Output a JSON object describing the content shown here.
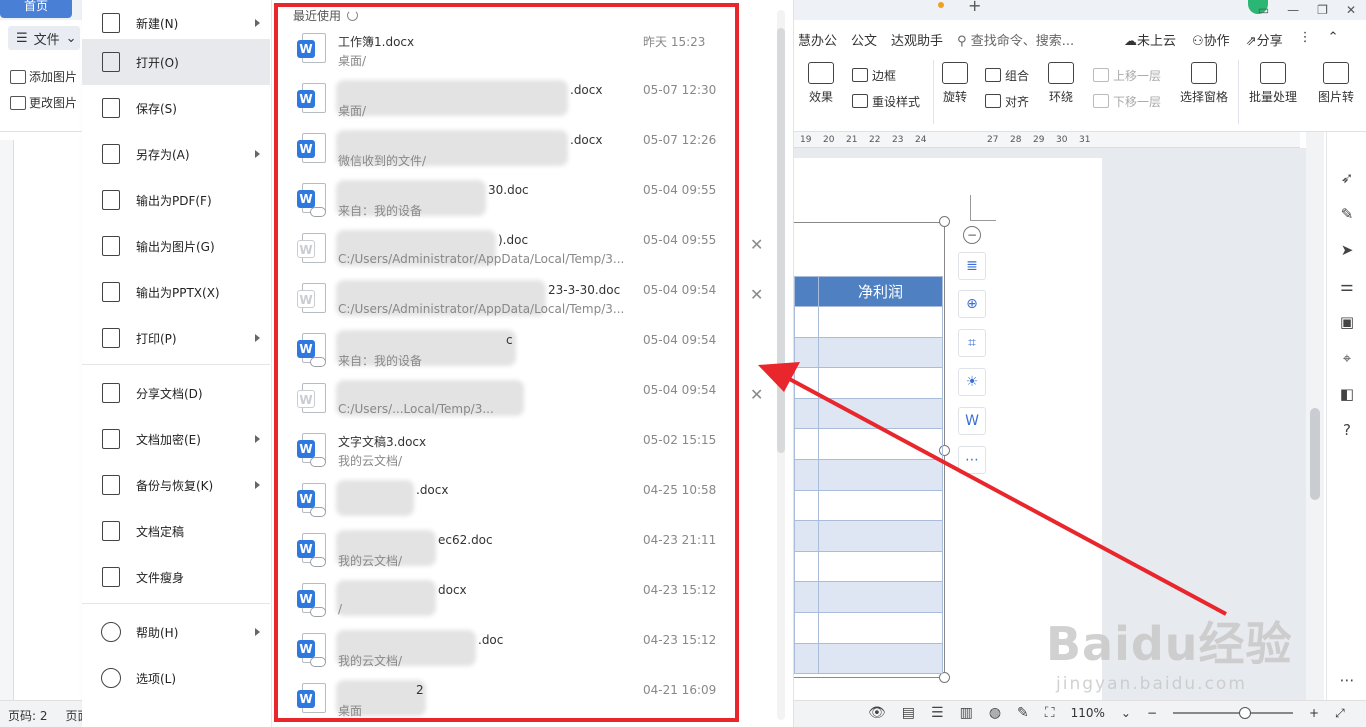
{
  "tabs": {
    "home": "首页"
  },
  "menubar": {
    "file_label": "文件",
    "items": [
      "慧办公",
      "公文",
      "达观助手"
    ],
    "search_placeholder": "查找命令、搜索...",
    "right": [
      "未上云",
      "协作",
      "分享"
    ]
  },
  "ribbon": {
    "left": [
      "添加图片",
      "更改图片"
    ],
    "border": "边框",
    "effect": "效果",
    "reset_style": "重设样式",
    "rotate": "旋转",
    "group": "组合",
    "align": "对齐",
    "wrap": "环绕",
    "move_up": "上移一层",
    "move_down": "下移一层",
    "select_pane": "选择窗格",
    "batch": "批量处理",
    "image_tools": "图片转"
  },
  "ruler": {
    "marks": [
      "19",
      "20",
      "21",
      "22",
      "23",
      "24",
      "27",
      "28",
      "29",
      "30",
      "31"
    ]
  },
  "table": {
    "header": "净利润"
  },
  "status": {
    "page": "页码: 2",
    "page2": "页面",
    "zoom": "110%"
  },
  "watermark": {
    "main": "Baidu经验",
    "sub": "jingyan.baidu.com"
  },
  "file_menu": {
    "items": [
      {
        "label": "新建(N)",
        "arrow": true,
        "icon": "new-icon"
      },
      {
        "label": "打开(O)",
        "arrow": false,
        "icon": "open-folder-icon"
      },
      {
        "label": "保存(S)",
        "arrow": false,
        "icon": "save-icon"
      },
      {
        "label": "另存为(A)",
        "arrow": true,
        "icon": "save-as-icon"
      },
      {
        "label": "输出为PDF(F)",
        "arrow": false,
        "icon": "pdf-icon"
      },
      {
        "label": "输出为图片(G)",
        "arrow": false,
        "icon": "image-export-icon"
      },
      {
        "label": "输出为PPTX(X)",
        "arrow": false,
        "icon": "pptx-icon"
      },
      {
        "label": "打印(P)",
        "arrow": true,
        "icon": "print-icon"
      },
      {
        "label": "分享文档(D)",
        "arrow": false,
        "icon": "share-icon"
      },
      {
        "label": "文档加密(E)",
        "arrow": true,
        "icon": "encrypt-icon"
      },
      {
        "label": "备份与恢复(K)",
        "arrow": true,
        "icon": "backup-icon"
      },
      {
        "label": "文档定稿",
        "arrow": false,
        "icon": "finalize-icon"
      },
      {
        "label": "文件瘦身",
        "arrow": false,
        "icon": "slim-icon"
      },
      {
        "label": "帮助(H)",
        "arrow": true,
        "icon": "help-icon"
      },
      {
        "label": "选项(L)",
        "arrow": false,
        "icon": "options-icon"
      }
    ]
  },
  "recent": {
    "title": "最近使用",
    "items": [
      {
        "name": "工作簿1.docx",
        "path": "桌面/",
        "time": "昨天  15:23",
        "icon": "word",
        "cloud": false,
        "close": false
      },
      {
        "name": ".docx",
        "path": "桌面/",
        "time": "05-07 12:30",
        "icon": "word",
        "cloud": false,
        "close": false
      },
      {
        "name": ".docx",
        "path": "微信收到的文件/",
        "time": "05-07 12:26",
        "icon": "word",
        "cloud": false,
        "close": false
      },
      {
        "name": "30.doc",
        "path": "来自：我的设备",
        "time": "05-04 09:55",
        "icon": "word",
        "cloud": true,
        "close": false
      },
      {
        "name": ").doc",
        "path": "C:/Users/Administrator/AppData/Local/Temp/3...",
        "time": "05-04 09:55",
        "icon": "grey",
        "cloud": false,
        "close": true
      },
      {
        "name": "23-3-30.doc",
        "path": "C:/Users/Administrator/AppData/Local/Temp/3...",
        "time": "05-04 09:54",
        "icon": "grey",
        "cloud": false,
        "close": true
      },
      {
        "name": "c",
        "path": "来自：我的设备",
        "time": "05-04 09:54",
        "icon": "word",
        "cloud": true,
        "close": false
      },
      {
        "name": "",
        "path": "C:/Users/...Local/Temp/3...",
        "time": "05-04 09:54",
        "icon": "grey",
        "cloud": false,
        "close": true
      },
      {
        "name": "文字文稿3.docx",
        "path": "我的云文档/",
        "time": "05-02 15:15",
        "icon": "word",
        "cloud": true,
        "close": false
      },
      {
        "name": ".docx",
        "path": "",
        "time": "04-25 10:58",
        "icon": "word",
        "cloud": true,
        "close": false
      },
      {
        "name": "ec62.doc",
        "path": "我的云文档/",
        "time": "04-23 21:11",
        "icon": "word",
        "cloud": true,
        "close": false
      },
      {
        "name": "docx",
        "path": "/",
        "time": "04-23 15:12",
        "icon": "word",
        "cloud": true,
        "close": false
      },
      {
        "name": ".doc",
        "path": "我的云文档/",
        "time": "04-23 15:12",
        "icon": "word",
        "cloud": true,
        "close": false
      },
      {
        "name": "2",
        "path": "桌面",
        "time": "04-21 16:09",
        "icon": "word",
        "cloud": false,
        "close": false
      }
    ]
  },
  "colors": {
    "accent": "#2f78e0",
    "annotation": "#e8262b",
    "table_header": "#4e80c2"
  }
}
